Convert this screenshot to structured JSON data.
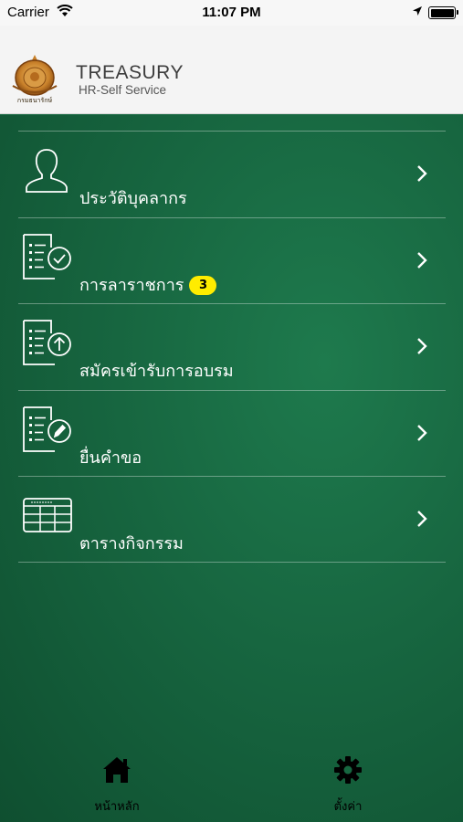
{
  "status": {
    "carrier": "Carrier",
    "time": "11:07 PM"
  },
  "header": {
    "title": "TREASURY",
    "subtitle": "HR-Self  Service",
    "logo_text": "กรมธนารักษ์"
  },
  "menu": [
    {
      "label": "ประวัติบุคลากร",
      "icon": "person-profile-icon"
    },
    {
      "label": "การลาราชการ",
      "icon": "document-check-icon",
      "badge": "3"
    },
    {
      "label": "สมัครเข้ารับการอบรม",
      "icon": "document-upload-icon"
    },
    {
      "label": "ยื่นคำขอ",
      "icon": "document-edit-icon"
    },
    {
      "label": "ตารางกิจกรรม",
      "icon": "calendar-table-icon"
    }
  ],
  "tabs": [
    {
      "label": "หน้าหลัก",
      "icon": "home-icon"
    },
    {
      "label": "ตั้งค่า",
      "icon": "gear-icon"
    }
  ],
  "colors": {
    "background": "#176640",
    "badge": "#ffec00",
    "header": "#f4f4f4"
  }
}
